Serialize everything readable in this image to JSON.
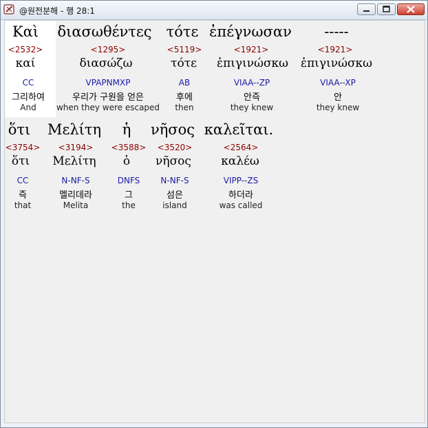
{
  "window": {
    "title": "@원전분해 - 행 28:1"
  },
  "lines": [
    {
      "words": [
        {
          "greek": "Καὶ",
          "strong": "<2532>",
          "lemma": "καί",
          "parse": "CC",
          "korean": "그리하여",
          "english": "And"
        },
        {
          "greek": "διασωθέντες",
          "strong": "<1295>",
          "lemma": "διασώζω",
          "parse": "VPAPNMXP",
          "korean": "우리가 구원을 얻은",
          "english": "when they were escaped"
        },
        {
          "greek": "τότε",
          "strong": "<5119>",
          "lemma": "τότε",
          "parse": "AB",
          "korean": "후에",
          "english": "then"
        },
        {
          "greek": "ἐπέγνωσαν",
          "strong": "<1921>",
          "lemma": "ἐπιγινώσκω",
          "parse": "VIAA--ZP",
          "korean": "안즉",
          "english": "they knew"
        },
        {
          "greek": "-----",
          "strong": "<1921>",
          "lemma": "ἐπιγινώσκω",
          "parse": "VIAA--XP",
          "korean": "안",
          "english": "they knew"
        }
      ]
    },
    {
      "words": [
        {
          "greek": "ὅτι",
          "strong": "<3754>",
          "lemma": "ὅτι",
          "parse": "CC",
          "korean": "즉",
          "english": "that"
        },
        {
          "greek": "Μελίτη",
          "strong": "<3194>",
          "lemma": "Μελίτη",
          "parse": "N-NF-S",
          "korean": "멜리데라",
          "english": "Melita"
        },
        {
          "greek": "ἡ",
          "strong": "<3588>",
          "lemma": "ὁ",
          "parse": "DNFS",
          "korean": "그",
          "english": "the"
        },
        {
          "greek": "νῆσος",
          "strong": "<3520>",
          "lemma": "νῆσος",
          "parse": "N-NF-S",
          "korean": "섬은",
          "english": "island"
        },
        {
          "greek": "καλεῖται.",
          "strong": "<2564>",
          "lemma": "καλέω",
          "parse": "VIPP--ZS",
          "korean": "하더라",
          "english": "was called"
        }
      ]
    }
  ]
}
